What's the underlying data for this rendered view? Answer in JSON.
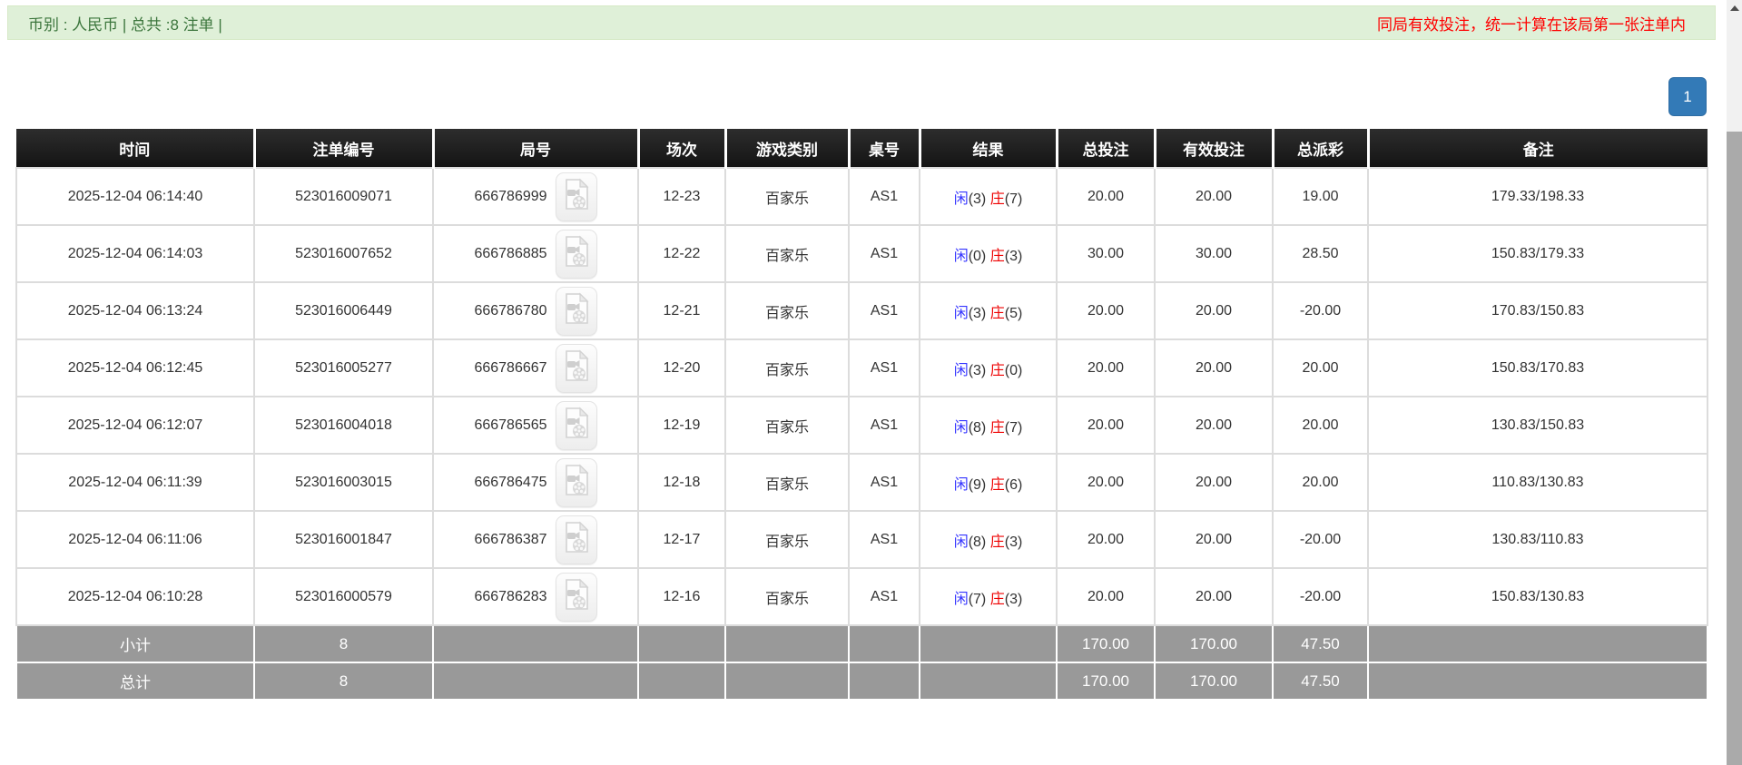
{
  "top_bar": {
    "left_text": "币别 : 人民币 | 总共 :8 注单 |",
    "right_notice": "同局有效投注，统一计算在该局第一张注单内"
  },
  "pagination": {
    "current_page": "1"
  },
  "table": {
    "columns": [
      "时间",
      "注单编号",
      "局号",
      "场次",
      "游戏类别",
      "桌号",
      "结果",
      "总投注",
      "有效投注",
      "总派彩",
      "备注"
    ],
    "rows": [
      {
        "time": "2025-12-04 06:14:40",
        "bet_id": "523016009071",
        "round_id": "666786999",
        "session": "12-23",
        "game_type": "百家乐",
        "table_id": "AS1",
        "result": {
          "player_label": "闲",
          "player_score": "(3)",
          "banker_label": "庄",
          "banker_score": "(7)"
        },
        "total_bet": "20.00",
        "valid_bet": "20.00",
        "payout": "19.00",
        "remark": "179.33/198.33"
      },
      {
        "time": "2025-12-04 06:14:03",
        "bet_id": "523016007652",
        "round_id": "666786885",
        "session": "12-22",
        "game_type": "百家乐",
        "table_id": "AS1",
        "result": {
          "player_label": "闲",
          "player_score": "(0)",
          "banker_label": "庄",
          "banker_score": "(3)"
        },
        "total_bet": "30.00",
        "valid_bet": "30.00",
        "payout": "28.50",
        "remark": "150.83/179.33"
      },
      {
        "time": "2025-12-04 06:13:24",
        "bet_id": "523016006449",
        "round_id": "666786780",
        "session": "12-21",
        "game_type": "百家乐",
        "table_id": "AS1",
        "result": {
          "player_label": "闲",
          "player_score": "(3)",
          "banker_label": "庄",
          "banker_score": "(5)"
        },
        "total_bet": "20.00",
        "valid_bet": "20.00",
        "payout": "-20.00",
        "remark": "170.83/150.83"
      },
      {
        "time": "2025-12-04 06:12:45",
        "bet_id": "523016005277",
        "round_id": "666786667",
        "session": "12-20",
        "game_type": "百家乐",
        "table_id": "AS1",
        "result": {
          "player_label": "闲",
          "player_score": "(3)",
          "banker_label": "庄",
          "banker_score": "(0)"
        },
        "total_bet": "20.00",
        "valid_bet": "20.00",
        "payout": "20.00",
        "remark": "150.83/170.83"
      },
      {
        "time": "2025-12-04 06:12:07",
        "bet_id": "523016004018",
        "round_id": "666786565",
        "session": "12-19",
        "game_type": "百家乐",
        "table_id": "AS1",
        "result": {
          "player_label": "闲",
          "player_score": "(8)",
          "banker_label": "庄",
          "banker_score": "(7)"
        },
        "total_bet": "20.00",
        "valid_bet": "20.00",
        "payout": "20.00",
        "remark": "130.83/150.83"
      },
      {
        "time": "2025-12-04 06:11:39",
        "bet_id": "523016003015",
        "round_id": "666786475",
        "session": "12-18",
        "game_type": "百家乐",
        "table_id": "AS1",
        "result": {
          "player_label": "闲",
          "player_score": "(9)",
          "banker_label": "庄",
          "banker_score": "(6)"
        },
        "total_bet": "20.00",
        "valid_bet": "20.00",
        "payout": "20.00",
        "remark": "110.83/130.83"
      },
      {
        "time": "2025-12-04 06:11:06",
        "bet_id": "523016001847",
        "round_id": "666786387",
        "session": "12-17",
        "game_type": "百家乐",
        "table_id": "AS1",
        "result": {
          "player_label": "闲",
          "player_score": "(8)",
          "banker_label": "庄",
          "banker_score": "(3)"
        },
        "total_bet": "20.00",
        "valid_bet": "20.00",
        "payout": "-20.00",
        "remark": "130.83/110.83"
      },
      {
        "time": "2025-12-04 06:10:28",
        "bet_id": "523016000579",
        "round_id": "666786283",
        "session": "12-16",
        "game_type": "百家乐",
        "table_id": "AS1",
        "result": {
          "player_label": "闲",
          "player_score": "(7)",
          "banker_label": "庄",
          "banker_score": "(3)"
        },
        "total_bet": "20.00",
        "valid_bet": "20.00",
        "payout": "-20.00",
        "remark": "150.83/130.83"
      }
    ],
    "subtotal": {
      "label": "小计",
      "count": "8",
      "total_bet": "170.00",
      "valid_bet": "170.00",
      "payout": "47.50"
    },
    "total": {
      "label": "总计",
      "count": "8",
      "total_bet": "170.00",
      "valid_bet": "170.00",
      "payout": "47.50"
    }
  },
  "icons": {
    "video_replay": "video-file-icon",
    "scroll_up": "up-arrow-icon"
  },
  "colors": {
    "header_bg": "#1f1f1f",
    "summary_row_bg": "#999999",
    "success_bg": "#dff0d8",
    "success_text": "#3c763d",
    "notice_red": "#ff0000",
    "player_blue": "#3333ff",
    "banker_red": "#ee0000",
    "link_blue": "#337ab7",
    "negative_red": "#ff0000",
    "pager_blue": "#337ab7"
  }
}
